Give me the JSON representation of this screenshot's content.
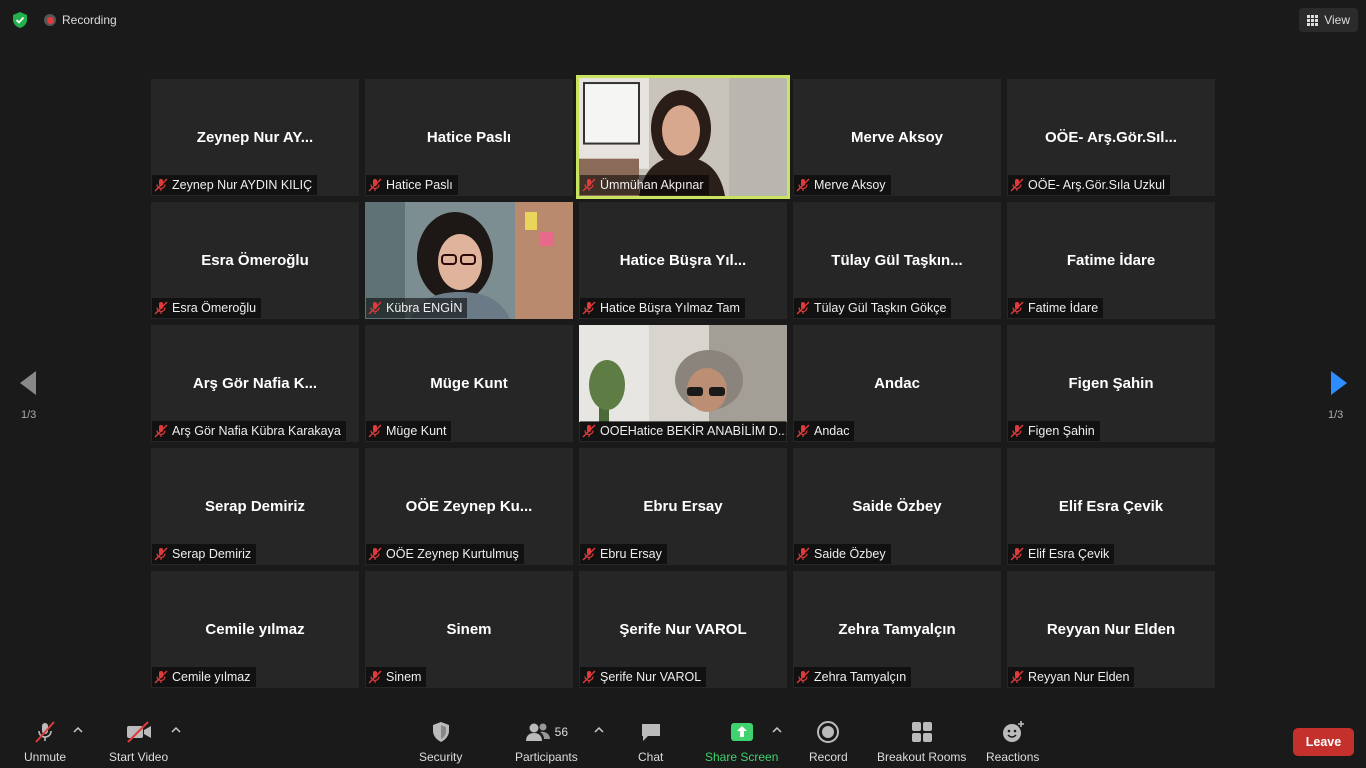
{
  "topbar": {
    "recording_label": "Recording",
    "view_label": "View"
  },
  "gallery": {
    "page_indicator_left": "1/3",
    "page_indicator_right": "1/3",
    "participants": [
      {
        "display": "Zeynep Nur AY...",
        "label": "Zeynep Nur AYDIN KILIÇ",
        "video": false
      },
      {
        "display": "Hatice Paslı",
        "label": "Hatice Paslı",
        "video": false
      },
      {
        "display": "",
        "label": "Ümmühan Akpınar",
        "video": true,
        "active": true
      },
      {
        "display": "Merve Aksoy",
        "label": "Merve Aksoy",
        "video": false
      },
      {
        "display": "OÖE-  Arş.Gör.Sıl...",
        "label": "OÖE- Arş.Gör.Sıla Uzkul",
        "video": false
      },
      {
        "display": "Esra Ömeroğlu",
        "label": "Esra Ömeroğlu",
        "video": false
      },
      {
        "display": "",
        "label": "Kübra ENGİN",
        "video": true
      },
      {
        "display": "Hatice Büşra Yıl...",
        "label": "Hatice Büşra Yılmaz Tam",
        "video": false
      },
      {
        "display": "Tülay Gül Taşkın...",
        "label": "Tülay Gül Taşkın Gökçe",
        "video": false
      },
      {
        "display": "Fatime İdare",
        "label": "Fatime İdare",
        "video": false
      },
      {
        "display": "Arş Gör Nafia K...",
        "label": "Arş Gör Nafia Kübra Karakaya",
        "video": false
      },
      {
        "display": "Müge Kunt",
        "label": "Müge Kunt",
        "video": false
      },
      {
        "display": "",
        "label": "OOEHatice BEKİR ANABİLİM D...",
        "video": true
      },
      {
        "display": "Andac",
        "label": "Andac",
        "video": false
      },
      {
        "display": "Figen Şahin",
        "label": "Figen Şahin",
        "video": false
      },
      {
        "display": "Serap Demiriz",
        "label": "Serap Demiriz",
        "video": false
      },
      {
        "display": "OÖE  Zeynep Ku...",
        "label": "OÖE Zeynep Kurtulmuş",
        "video": false
      },
      {
        "display": "Ebru Ersay",
        "label": "Ebru Ersay",
        "video": false
      },
      {
        "display": "Saide Özbey",
        "label": "Saide Özbey",
        "video": false
      },
      {
        "display": "Elif Esra Çevik",
        "label": "Elif Esra Çevik",
        "video": false
      },
      {
        "display": "Cemile yılmaz",
        "label": "Cemile yılmaz",
        "video": false
      },
      {
        "display": "Sinem",
        "label": "Sinem",
        "video": false
      },
      {
        "display": "Şerife Nur VAROL",
        "label": "Şerife Nur VAROL",
        "video": false
      },
      {
        "display": "Zehra Tamyalçın",
        "label": "Zehra Tamyalçın",
        "video": false
      },
      {
        "display": "Reyyan Nur Elden",
        "label": "Reyyan Nur Elden",
        "video": false
      }
    ]
  },
  "toolbar": {
    "unmute": "Unmute",
    "start_video": "Start Video",
    "security": "Security",
    "participants": "Participants",
    "participant_count": "56",
    "chat": "Chat",
    "share_screen": "Share Screen",
    "record": "Record",
    "breakout_rooms": "Breakout Rooms",
    "reactions": "Reactions",
    "leave": "Leave"
  },
  "colors": {
    "active_speaker_border": "#c9e25f",
    "leave_button": "#c4302b",
    "share_screen_green": "#3fd26e",
    "muted_red": "#e03b3b",
    "nav_arrow_blue": "#2d8cff"
  }
}
